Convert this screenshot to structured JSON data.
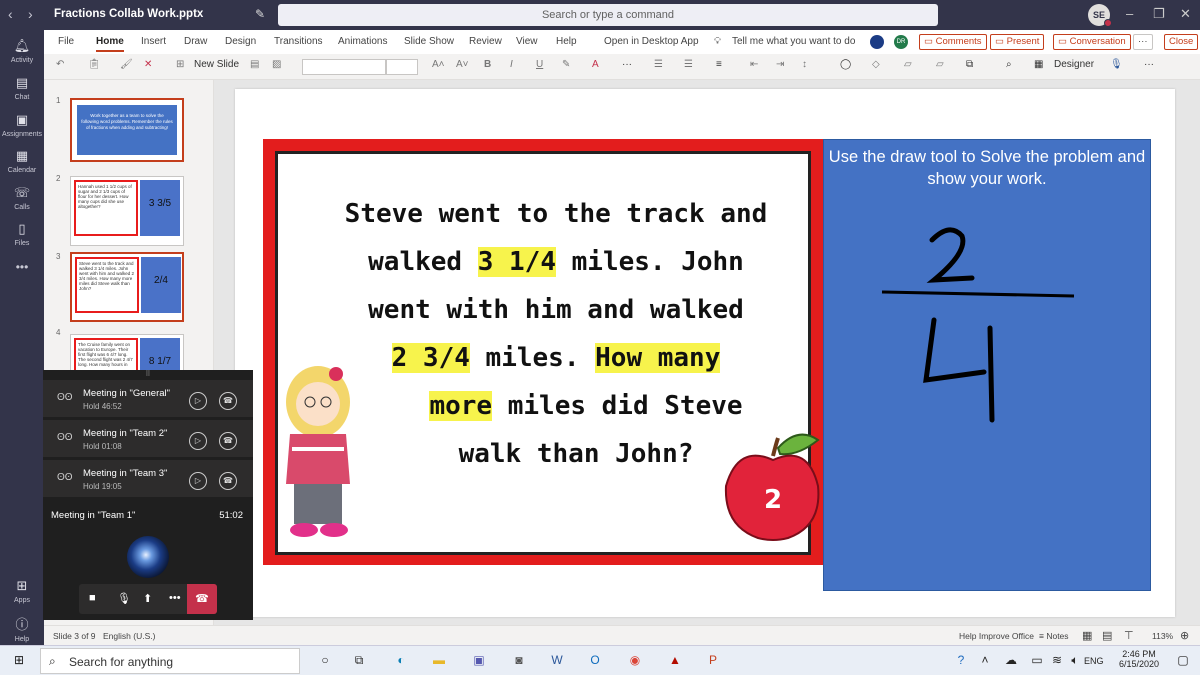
{
  "window": {
    "back_glyph": "‹",
    "forward_glyph": "›",
    "title": "Fractions Collab Work.pptx",
    "search_placeholder": "Search or type a command",
    "avatar": "SE",
    "minimize": "–",
    "restore": "❐",
    "close": "✕"
  },
  "rail": {
    "items": [
      {
        "label": "Activity",
        "icon": "bell-icon"
      },
      {
        "label": "Chat",
        "icon": "chat-icon"
      },
      {
        "label": "Assignments",
        "icon": "assignments-icon"
      },
      {
        "label": "Calendar",
        "icon": "calendar-icon"
      },
      {
        "label": "Calls",
        "icon": "phone-icon"
      },
      {
        "label": "Files",
        "icon": "files-icon"
      },
      {
        "label": "Apps",
        "icon": "apps-icon"
      },
      {
        "label": "Help",
        "icon": "help-icon"
      }
    ],
    "more": "•••"
  },
  "menu": {
    "tabs": [
      "File",
      "Home",
      "Insert",
      "Draw",
      "Design",
      "Transitions",
      "Animations",
      "Slide Show",
      "Review",
      "View",
      "Help"
    ],
    "active": "Home",
    "open_desktop": "Open in Desktop App",
    "tell_me": "Tell me what you want to do",
    "dr": "DR",
    "comments": "Comments",
    "present": "Present",
    "conversation": "Conversation",
    "more": "···",
    "close": "Close"
  },
  "ribbon": {
    "new_slide": "New Slide",
    "designer": "Designer"
  },
  "thumbnails": {
    "numbers": [
      "1",
      "2",
      "3",
      "4"
    ],
    "t1_text": "Work together as a team to solve the following word problems. Remember the rules of fractions when adding and subtracting!",
    "t2_text": "Hannah used 1 1/2 cups of sugar and 2 1/3 cups of flour for her dessert. How many cups did she use altogether?",
    "t2_fraction": "3 3/5",
    "t3_text": "Steve went to the track and walked 3 1/4 miles. John went with him and walked 2 3/4 miles. How many more miles did Steve walk than John?",
    "t3_fraction": "2/4",
    "t4_text": "The Cruise family went on vacation to Europe. Their first flight was 6 4/7 long. The second flight was 2 4/7 long. How many hours in",
    "t4_fraction": "8 1/7"
  },
  "slide": {
    "line1": "Steve went to the track and",
    "line2_pre": "walked ",
    "line2_hl": "3 1/4",
    "line2_post": " miles. John",
    "line3": "went with him and walked",
    "line4_hl": "2 3/4",
    "line4_mid": " miles. ",
    "line4_hl2": "How many",
    "line5_hl": "more",
    "line5_post": " miles did Steve",
    "line6": "walk than John?",
    "apple_number": "2",
    "instructions": "Use the draw tool to Solve the problem and show your work.",
    "ink_numerator": "2",
    "ink_denominator": "4"
  },
  "calls": {
    "handle": "⠿",
    "held": [
      {
        "name": "Meeting in \"General\"",
        "status": "Hold",
        "time": "46:52"
      },
      {
        "name": "Meeting in \"Team 2\"",
        "status": "Hold",
        "time": "01:08"
      },
      {
        "name": "Meeting in \"Team 3\"",
        "status": "Hold",
        "time": "19:05"
      }
    ],
    "current_name": "Meeting in \"Team 1\"",
    "current_time": "51:02"
  },
  "status": {
    "slide_count": "Slide 3 of 9",
    "language": "English (U.S.)",
    "feedback": "Help Improve Office",
    "notes": "Notes",
    "zoom": "113%"
  },
  "taskbar": {
    "search": "Search for anything",
    "time": "2:46 PM",
    "date": "6/15/2020",
    "lang": "ENG"
  }
}
